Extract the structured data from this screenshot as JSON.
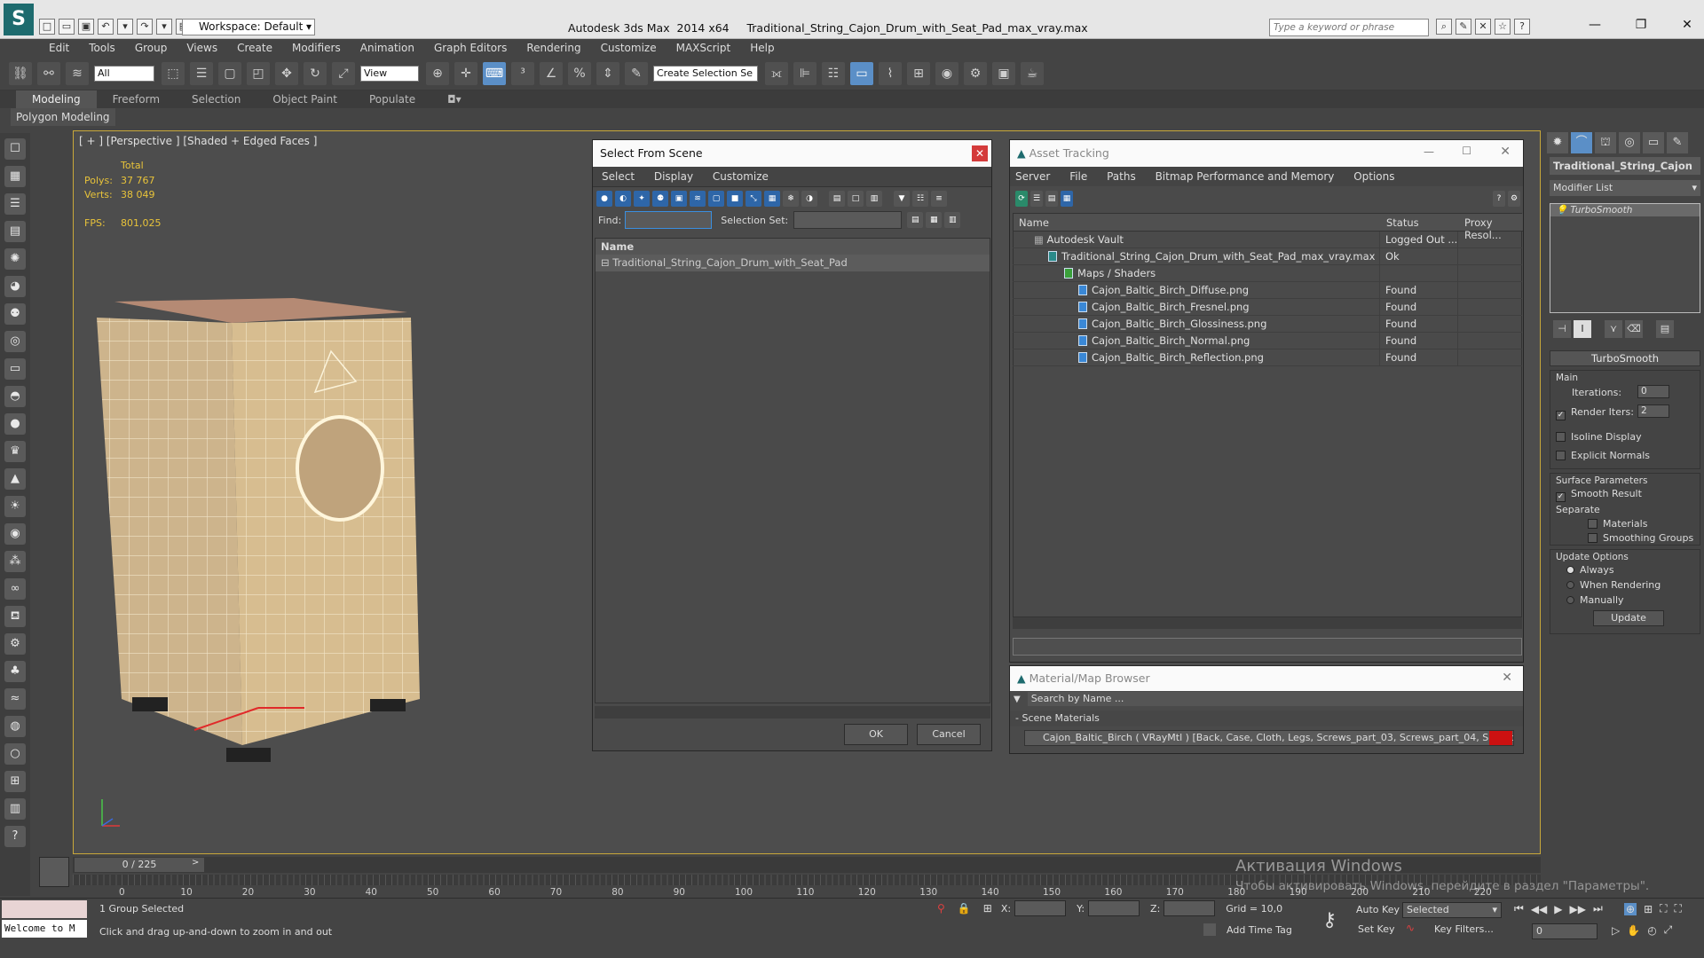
{
  "titlebar": {
    "workspace": "Workspace: Default",
    "title": "Autodesk 3ds Max  2014 x64     Traditional_String_Cajon_Drum_with_Seat_Pad_max_vray.max",
    "search_placeholder": "Type a keyword or phrase"
  },
  "menu": [
    "Edit",
    "Tools",
    "Group",
    "Views",
    "Create",
    "Modifiers",
    "Animation",
    "Graph Editors",
    "Rendering",
    "Customize",
    "MAXScript",
    "Help"
  ],
  "toolbar": {
    "filter_value": "All",
    "ref_coord_value": "View",
    "selection_set_placeholder": "Create Selection Se"
  },
  "ribbon": {
    "tabs": [
      "Modeling",
      "Freeform",
      "Selection",
      "Object Paint",
      "Populate"
    ],
    "sub_label": "Polygon Modeling"
  },
  "viewport": {
    "label": "[ + ] [Perspective ] [Shaded + Edged Faces ]",
    "total_label": "Total",
    "polys_label": "Polys:",
    "polys_value": "37 767",
    "verts_label": "Verts:",
    "verts_value": "38 049",
    "fps_label": "FPS:",
    "fps_value": "801,025"
  },
  "select_from_scene": {
    "title": "Select From Scene",
    "menu": [
      "Select",
      "Display",
      "Customize"
    ],
    "find_label": "Find:",
    "selection_set_label": "Selection Set:",
    "column_name": "Name",
    "items": [
      "Traditional_String_Cajon_Drum_with_Seat_Pad"
    ],
    "ok": "OK",
    "cancel": "Cancel"
  },
  "asset_tracking": {
    "title": "Asset Tracking",
    "menu": [
      "Server",
      "File",
      "Paths",
      "Bitmap Performance and Memory",
      "Options"
    ],
    "columns": [
      "Name",
      "Status",
      "Proxy Resol..."
    ],
    "rows": [
      {
        "name": "Autodesk Vault",
        "status": "Logged Out ..."
      },
      {
        "name": "Traditional_String_Cajon_Drum_with_Seat_Pad_max_vray.max",
        "status": "Ok"
      },
      {
        "name": "Maps / Shaders",
        "status": ""
      },
      {
        "name": "Cajon_Baltic_Birch_Diffuse.png",
        "status": "Found"
      },
      {
        "name": "Cajon_Baltic_Birch_Fresnel.png",
        "status": "Found"
      },
      {
        "name": "Cajon_Baltic_Birch_Glossiness.png",
        "status": "Found"
      },
      {
        "name": "Cajon_Baltic_Birch_Normal.png",
        "status": "Found"
      },
      {
        "name": "Cajon_Baltic_Birch_Reflection.png",
        "status": "Found"
      }
    ]
  },
  "material_browser": {
    "title": "Material/Map Browser",
    "search_placeholder": "Search by Name ...",
    "group_label": "- Scene Materials",
    "material": "Cajon_Baltic_Birch  ( VRayMtl )  [Back, Case, Cloth, Legs, Screws_part_03, Screws_part_04, Seat_part..."
  },
  "command_panel": {
    "object_name": "Traditional_String_Cajon",
    "modifier_list_label": "Modifier List",
    "stack_item": "TurboSmooth",
    "rollout_title": "TurboSmooth",
    "main_label": "Main",
    "iterations_label": "Iterations:",
    "iterations_value": "0",
    "render_iters_label": "Render Iters:",
    "render_iters_value": "2",
    "isoline_label": "Isoline Display",
    "explicit_normals_label": "Explicit Normals",
    "surface_params_label": "Surface Parameters",
    "smooth_result_label": "Smooth Result",
    "separate_label": "Separate",
    "materials_label": "Materials",
    "smoothing_groups_label": "Smoothing Groups",
    "update_options_label": "Update Options",
    "always_label": "Always",
    "when_rendering_label": "When Rendering",
    "manually_label": "Manually",
    "update_button": "Update"
  },
  "timeline": {
    "frame_counter": "0 / 225",
    "ticks": [
      "0",
      "10",
      "20",
      "30",
      "40",
      "50",
      "60",
      "70",
      "80",
      "90",
      "100",
      "110",
      "120",
      "130",
      "140",
      "150",
      "160",
      "170",
      "180",
      "190",
      "200",
      "210",
      "220"
    ]
  },
  "statusbar": {
    "maxscript_value": "Welcome to M",
    "selection_info": "1 Group Selected",
    "prompt": "Click and drag up-and-down to zoom in and out",
    "x_label": "X:",
    "y_label": "Y:",
    "z_label": "Z:",
    "grid": "Grid = 10,0",
    "add_time_tag": "Add Time Tag",
    "auto_key": "Auto Key",
    "selected_value": "Selected",
    "set_key": "Set Key",
    "key_filters": "Key Filters...",
    "frame_value": "0"
  },
  "watermark": {
    "line1": "Активация Windows",
    "line2": "Чтобы активировать Windows, перейдите в раздел \"Параметры\"."
  },
  "colors": {
    "viewport_border": "#c9a83a",
    "stats": "#e8c33a",
    "highlight_blue": "#5b8fc7",
    "material_swatch": "#cc1111"
  }
}
